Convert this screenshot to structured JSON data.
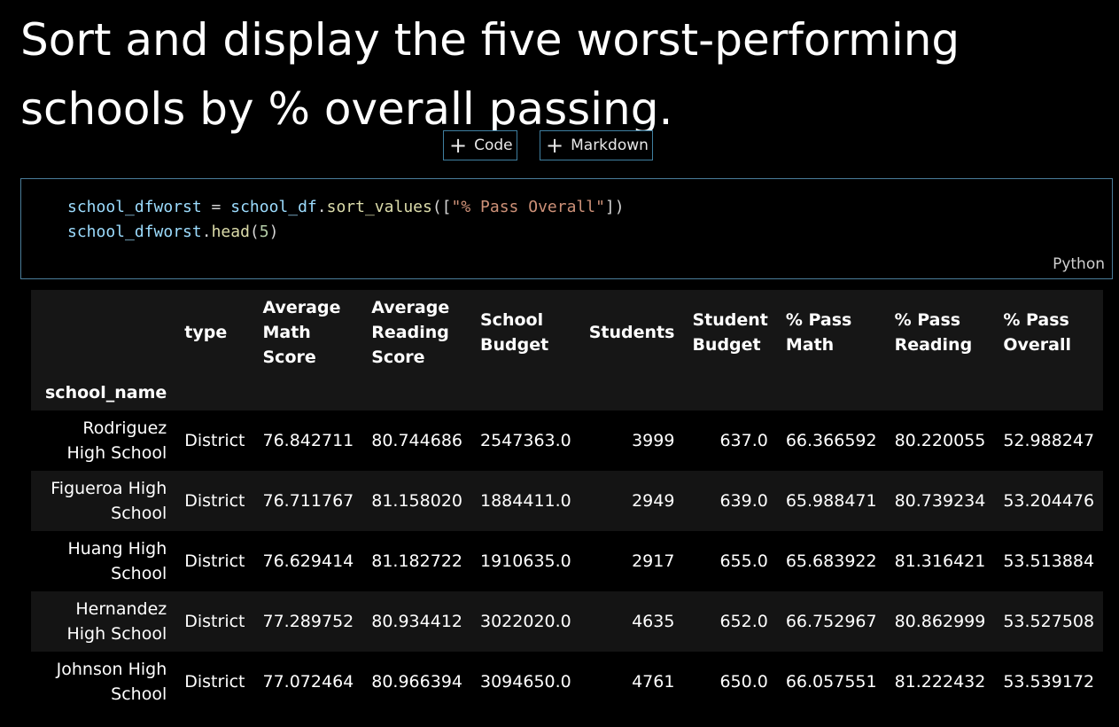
{
  "markdown": {
    "heading": "Sort and display the five worst-performing schools by % overall passing."
  },
  "insert_bar": {
    "code_label": "Code",
    "markdown_label": "Markdown"
  },
  "code_cell": {
    "language": "Python",
    "line1": {
      "var": "school_dfworst",
      "eq": " = ",
      "obj": "school_df",
      "dot": ".",
      "fn": "sort_values",
      "open": "([",
      "str": "\"% Pass Overall\"",
      "close": "])"
    },
    "line2": {
      "var": "school_dfworst",
      "dot": ".",
      "fn": "head",
      "open": "(",
      "num": "5",
      "close": ")"
    }
  },
  "output": {
    "index_name": "school_name",
    "columns": [
      "type",
      "Average Math Score",
      "Average Reading Score",
      "School Budget",
      "Students",
      "Student Budget",
      "% Pass Math",
      "% Pass Reading",
      "% Pass Overall"
    ],
    "rows": [
      {
        "school_name": "Rodriguez High School",
        "values": [
          "District",
          "76.842711",
          "80.744686",
          "2547363.0",
          "3999",
          "637.0",
          "66.366592",
          "80.220055",
          "52.988247"
        ]
      },
      {
        "school_name": "Figueroa High School",
        "values": [
          "District",
          "76.711767",
          "81.158020",
          "1884411.0",
          "2949",
          "639.0",
          "65.988471",
          "80.739234",
          "53.204476"
        ]
      },
      {
        "school_name": "Huang High School",
        "values": [
          "District",
          "76.629414",
          "81.182722",
          "1910635.0",
          "2917",
          "655.0",
          "65.683922",
          "81.316421",
          "53.513884"
        ]
      },
      {
        "school_name": "Hernandez High School",
        "values": [
          "District",
          "77.289752",
          "80.934412",
          "3022020.0",
          "4635",
          "652.0",
          "66.752967",
          "80.862999",
          "53.527508"
        ]
      },
      {
        "school_name": "Johnson High School",
        "values": [
          "District",
          "77.072464",
          "80.966394",
          "3094650.0",
          "4761",
          "650.0",
          "66.057551",
          "81.222432",
          "53.539172"
        ]
      }
    ]
  },
  "colors": {
    "background": "#000000",
    "cell_border": "#4a7d9a",
    "header_bg": "#161616",
    "string": "#ce9178",
    "variable": "#9cdcfe",
    "function": "#dcdcaa"
  }
}
